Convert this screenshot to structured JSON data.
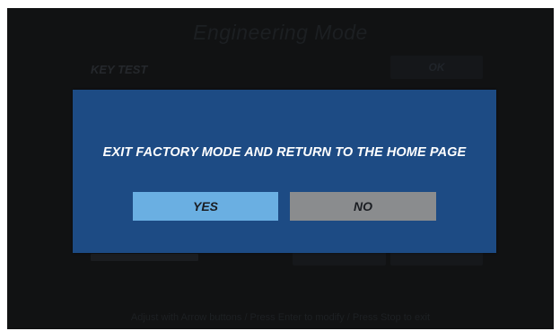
{
  "background": {
    "title": "Engineering Mode",
    "row_label": "KEY TEST",
    "row_button": "OK",
    "hint": "Adjust with Arrow buttons / Press Enter to modify / Press Stop to exit"
  },
  "dialog": {
    "message": "EXIT FACTORY MODE AND RETURN TO THE HOME PAGE",
    "yes_label": "YES",
    "no_label": "NO"
  },
  "colors": {
    "dialog_bg": "#1d4b84",
    "yes_selected": "#6aafe2",
    "no_unselected": "#8a8c8e",
    "screen_bg": "#111213"
  }
}
